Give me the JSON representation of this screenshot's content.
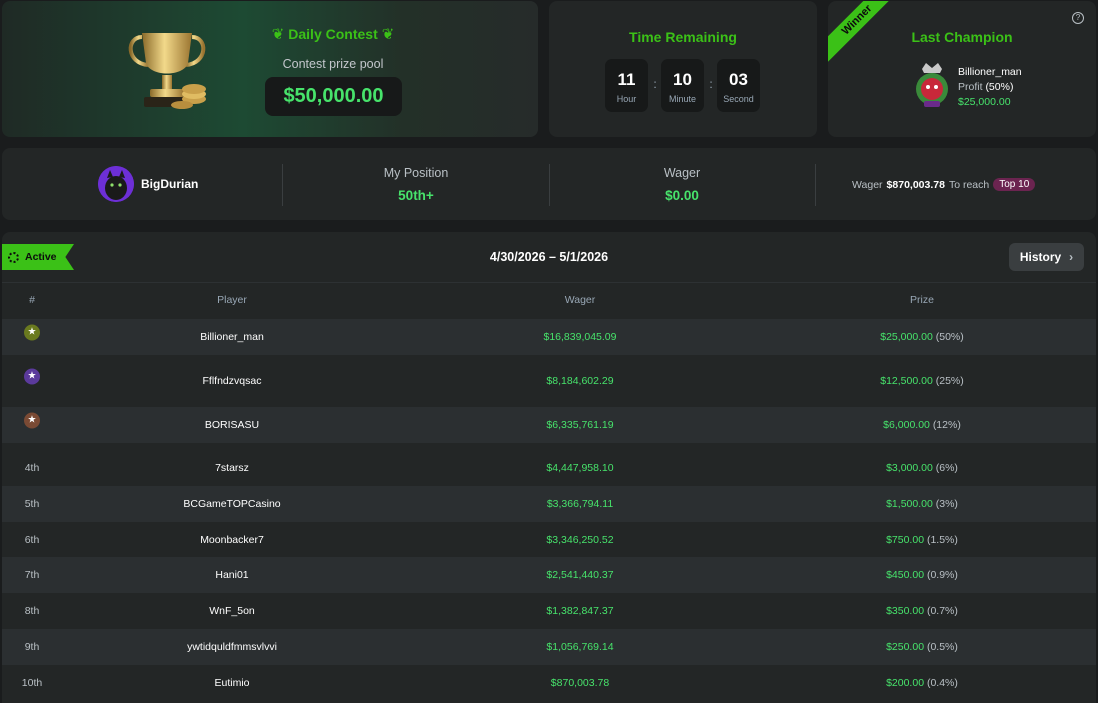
{
  "contest": {
    "title": "Daily Contest",
    "pool_label": "Contest prize pool",
    "pool_value": "$50,000.00"
  },
  "timer": {
    "title": "Time Remaining",
    "hours": "11",
    "hours_unit": "Hour",
    "minutes": "10",
    "minutes_unit": "Minute",
    "seconds": "03",
    "seconds_unit": "Second"
  },
  "champion": {
    "ribbon": "Winner",
    "title": "Last Champion",
    "name": "Billioner_man",
    "profit_label": "Profit",
    "profit_pct": "(50%)",
    "amount": "$25,000.00"
  },
  "stats": {
    "username": "BigDurian",
    "position_label": "My Position",
    "position_value": "50th+",
    "wager_label": "Wager",
    "wager_value": "$0.00",
    "reach_prefix": "Wager",
    "reach_amount": "$870,003.78",
    "reach_text": "To reach",
    "reach_badge": "Top 10"
  },
  "board": {
    "status": "Active",
    "date_range": "4/30/2026 – 5/1/2026",
    "history_label": "History",
    "columns": {
      "rank": "#",
      "player": "Player",
      "wager": "Wager",
      "prize": "Prize"
    },
    "rows": [
      {
        "rank": "",
        "medal": "gold",
        "player": "Billioner_man",
        "wager": "$16,839,045.09",
        "prize": "$25,000.00",
        "pct": "(50%)"
      },
      {
        "rank": "",
        "medal": "silver",
        "player": "Fflfndzvqsac",
        "wager": "$8,184,602.29",
        "prize": "$12,500.00",
        "pct": "(25%)"
      },
      {
        "rank": "",
        "medal": "bronze",
        "player": "BORISASU",
        "wager": "$6,335,761.19",
        "prize": "$6,000.00",
        "pct": "(12%)"
      },
      {
        "rank": "4th",
        "player": "7starsz",
        "wager": "$4,447,958.10",
        "prize": "$3,000.00",
        "pct": "(6%)"
      },
      {
        "rank": "5th",
        "player": "BCGameTOPCasino",
        "wager": "$3,366,794.11",
        "prize": "$1,500.00",
        "pct": "(3%)"
      },
      {
        "rank": "6th",
        "player": "Moonbacker7",
        "wager": "$3,346,250.52",
        "prize": "$750.00",
        "pct": "(1.5%)"
      },
      {
        "rank": "7th",
        "player": "Hani01",
        "wager": "$2,541,440.37",
        "prize": "$450.00",
        "pct": "(0.9%)"
      },
      {
        "rank": "8th",
        "player": "WnF_5on",
        "wager": "$1,382,847.37",
        "prize": "$350.00",
        "pct": "(0.7%)"
      },
      {
        "rank": "9th",
        "player": "ywtidquldfmmsvlvvi",
        "wager": "$1,056,769.14",
        "prize": "$250.00",
        "pct": "(0.5%)"
      },
      {
        "rank": "10th",
        "player": "Eutimio",
        "wager": "$870,003.78",
        "prize": "$200.00",
        "pct": "(0.4%)"
      }
    ]
  },
  "colors": {
    "accent": "#3bc117",
    "money": "#47e36b",
    "gold_medal": "#6a7a1f",
    "silver_medal": "#5b3a9c",
    "bronze_medal": "#7a4a34"
  }
}
